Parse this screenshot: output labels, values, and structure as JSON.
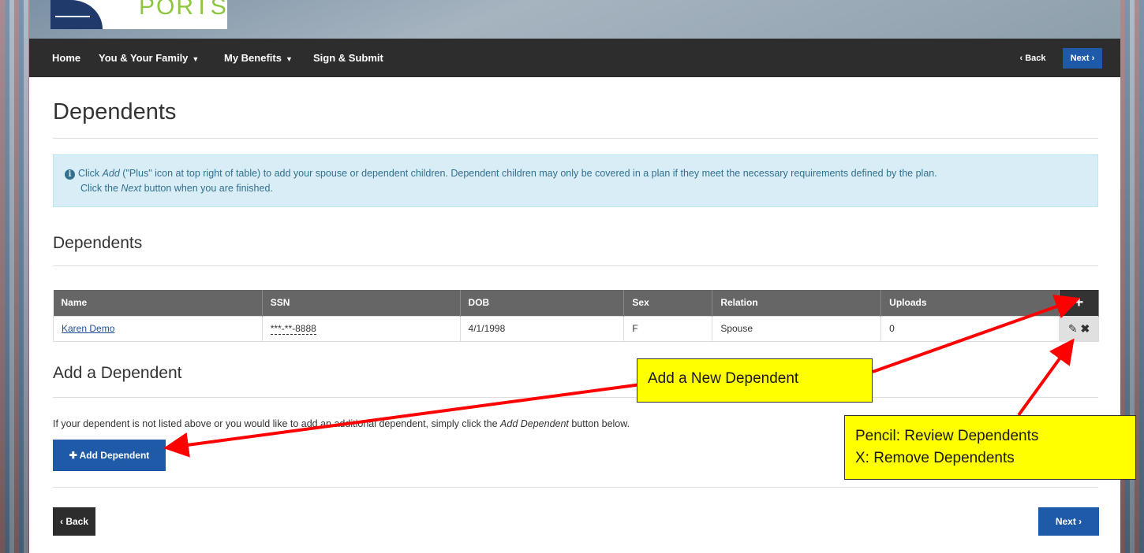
{
  "logo": {
    "text": "PORTS"
  },
  "nav": {
    "items": [
      {
        "label": "Home"
      },
      {
        "label": "You & Your Family"
      },
      {
        "label": "My Benefits"
      },
      {
        "label": "Sign & Submit"
      }
    ],
    "back_label": "Back",
    "next_label": "Next"
  },
  "page": {
    "title": "Dependents",
    "info": {
      "line1_a": "Click ",
      "line1_em": "Add",
      "line1_b": " (\"Plus\" icon at top right of table) to add your spouse or dependent children. Dependent children may only be covered in a plan if they meet the necessary requirements defined by the plan.",
      "line2_a": "Click the ",
      "line2_em": "Next",
      "line2_b": " button when you are finished."
    },
    "dependents_section_title": "Dependents",
    "table": {
      "headers": [
        "Name",
        "SSN",
        "DOB",
        "Sex",
        "Relation",
        "Uploads"
      ],
      "rows": [
        {
          "name": "Karen Demo",
          "ssn": "***-**-8888",
          "dob": "4/1/1998",
          "sex": "F",
          "relation": "Spouse",
          "uploads": "0"
        }
      ]
    },
    "add_section_title": "Add a Dependent",
    "add_text_a": "If your dependent is not listed above or you would like to add an additional dependent, simply click the ",
    "add_text_em": "Add Dependent",
    "add_text_b": " button below.",
    "add_button_label": "Add Dependent",
    "back_label": "Back",
    "next_label": "Next"
  },
  "callouts": {
    "add_new": "Add a New Dependent",
    "pencil": "Pencil: Review Dependents",
    "x": "X: Remove Dependents"
  },
  "colors": {
    "navbar": "#2d2d2d",
    "primary_button": "#1e5aa8",
    "info_bg": "#d9edf7",
    "callout_bg": "#ffff00",
    "arrow": "#ff0000"
  }
}
